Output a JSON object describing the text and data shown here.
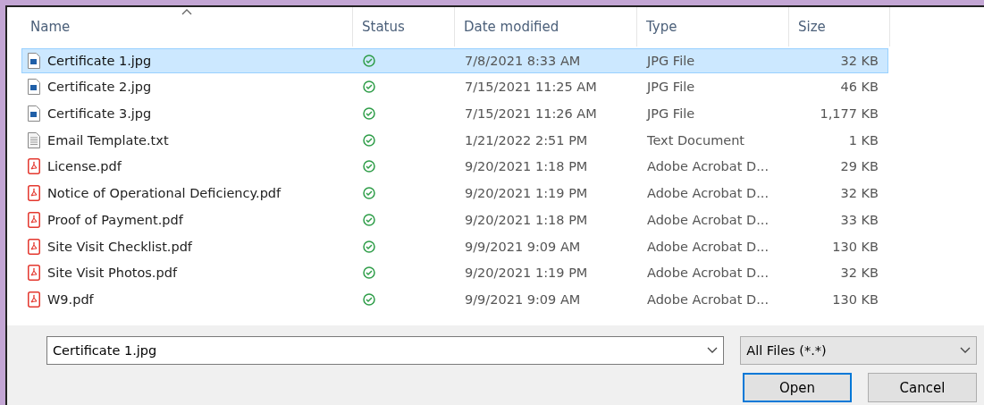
{
  "columns": [
    {
      "label": "Name",
      "sorted": true
    },
    {
      "label": "Status",
      "sorted": false
    },
    {
      "label": "Date modified",
      "sorted": false
    },
    {
      "label": "Type",
      "sorted": false
    },
    {
      "label": "Size",
      "sorted": false
    }
  ],
  "files": [
    {
      "name": "Certificate 1.jpg",
      "kind": "image",
      "date": "7/8/2021 8:33 AM",
      "type": "JPG File",
      "size": "32 KB",
      "selected": true
    },
    {
      "name": "Certificate 2.jpg",
      "kind": "image",
      "date": "7/15/2021 11:25 AM",
      "type": "JPG File",
      "size": "46 KB",
      "selected": false
    },
    {
      "name": "Certificate 3.jpg",
      "kind": "image",
      "date": "7/15/2021 11:26 AM",
      "type": "JPG File",
      "size": "1,177 KB",
      "selected": false
    },
    {
      "name": "Email Template.txt",
      "kind": "text",
      "date": "1/21/2022 2:51 PM",
      "type": "Text Document",
      "size": "1 KB",
      "selected": false
    },
    {
      "name": "License.pdf",
      "kind": "pdf",
      "date": "9/20/2021 1:18 PM",
      "type": "Adobe Acrobat D...",
      "size": "29 KB",
      "selected": false
    },
    {
      "name": "Notice of Operational Deficiency.pdf",
      "kind": "pdf",
      "date": "9/20/2021 1:19 PM",
      "type": "Adobe Acrobat D...",
      "size": "32 KB",
      "selected": false
    },
    {
      "name": "Proof of Payment.pdf",
      "kind": "pdf",
      "date": "9/20/2021 1:18 PM",
      "type": "Adobe Acrobat D...",
      "size": "33 KB",
      "selected": false
    },
    {
      "name": "Site Visit Checklist.pdf",
      "kind": "pdf",
      "date": "9/9/2021 9:09 AM",
      "type": "Adobe Acrobat D...",
      "size": "130 KB",
      "selected": false
    },
    {
      "name": "Site Visit Photos.pdf",
      "kind": "pdf",
      "date": "9/20/2021 1:19 PM",
      "type": "Adobe Acrobat D...",
      "size": "32 KB",
      "selected": false
    },
    {
      "name": "W9.pdf",
      "kind": "pdf",
      "date": "9/9/2021 9:09 AM",
      "type": "Adobe Acrobat D...",
      "size": "130 KB",
      "selected": false
    }
  ],
  "file_name": {
    "value": "Certificate 1.jpg"
  },
  "file_type": {
    "value": "All Files (*.*)"
  },
  "buttons": [
    {
      "label": "Open",
      "primary": true
    },
    {
      "label": "Cancel",
      "primary": false
    }
  ]
}
